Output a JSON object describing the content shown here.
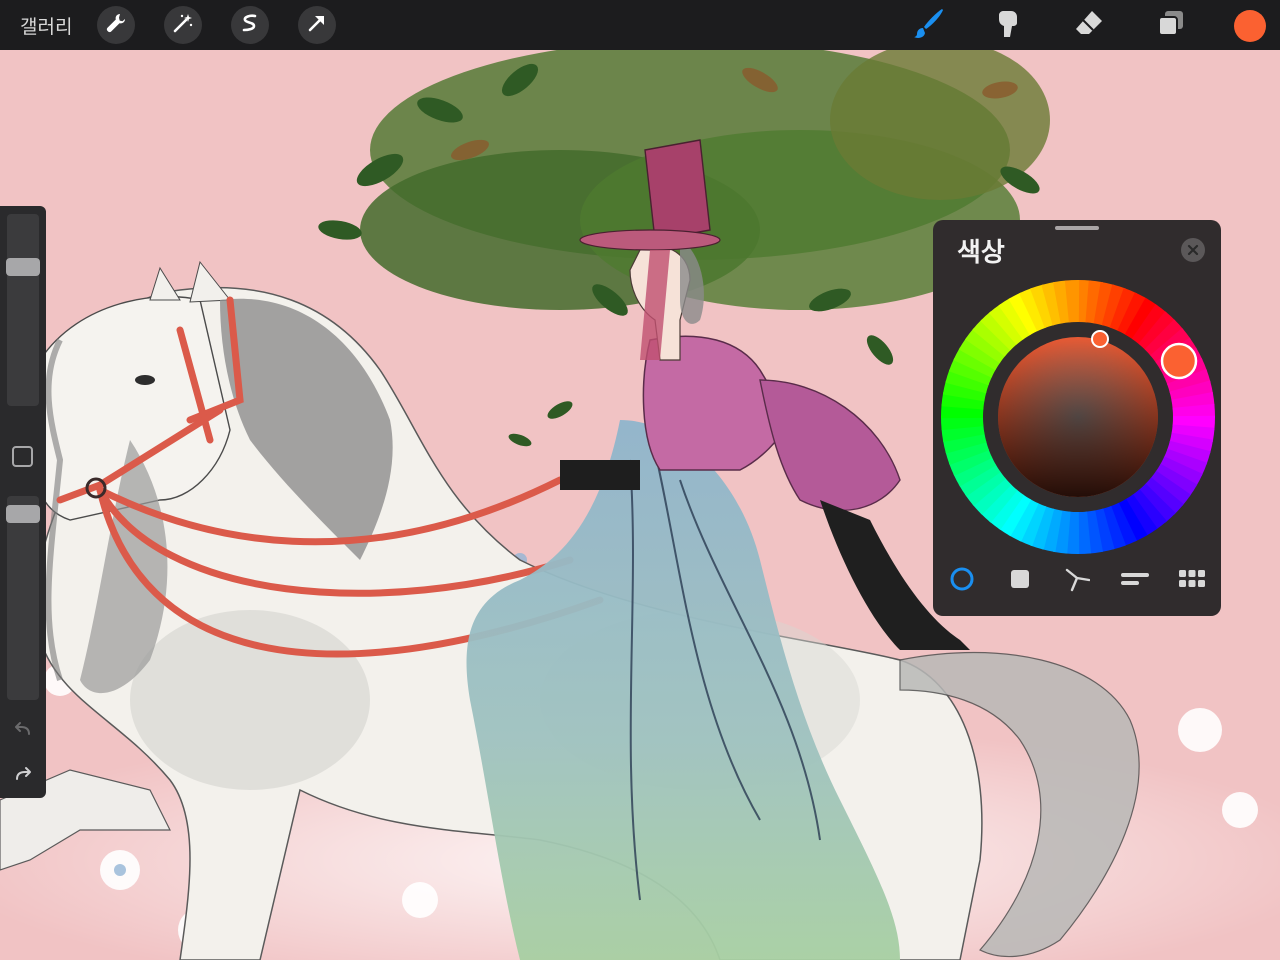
{
  "topbar": {
    "gallery_label": "갤러리",
    "left_tools": [
      "wrench-icon",
      "magic-wand-icon",
      "selection-icon",
      "transform-icon"
    ],
    "right_tools": [
      "brush-icon",
      "smudge-icon",
      "eraser-icon",
      "layers-icon"
    ],
    "active_tool": "brush-icon",
    "current_color": "#fb6131",
    "accent_color": "#1a8ff0"
  },
  "sidebar": {
    "brush_size_level": 0.75,
    "opacity_level": 0.95,
    "buttons": [
      "modify-button",
      "undo-icon",
      "redo-icon"
    ]
  },
  "color_panel": {
    "title": "색상",
    "close_icon": "close-icon",
    "selected_color": "#fb6131",
    "modes": [
      "disc-mode",
      "classic-mode",
      "harmony-mode",
      "value-mode",
      "palettes-mode"
    ],
    "active_mode": "disc-mode"
  }
}
